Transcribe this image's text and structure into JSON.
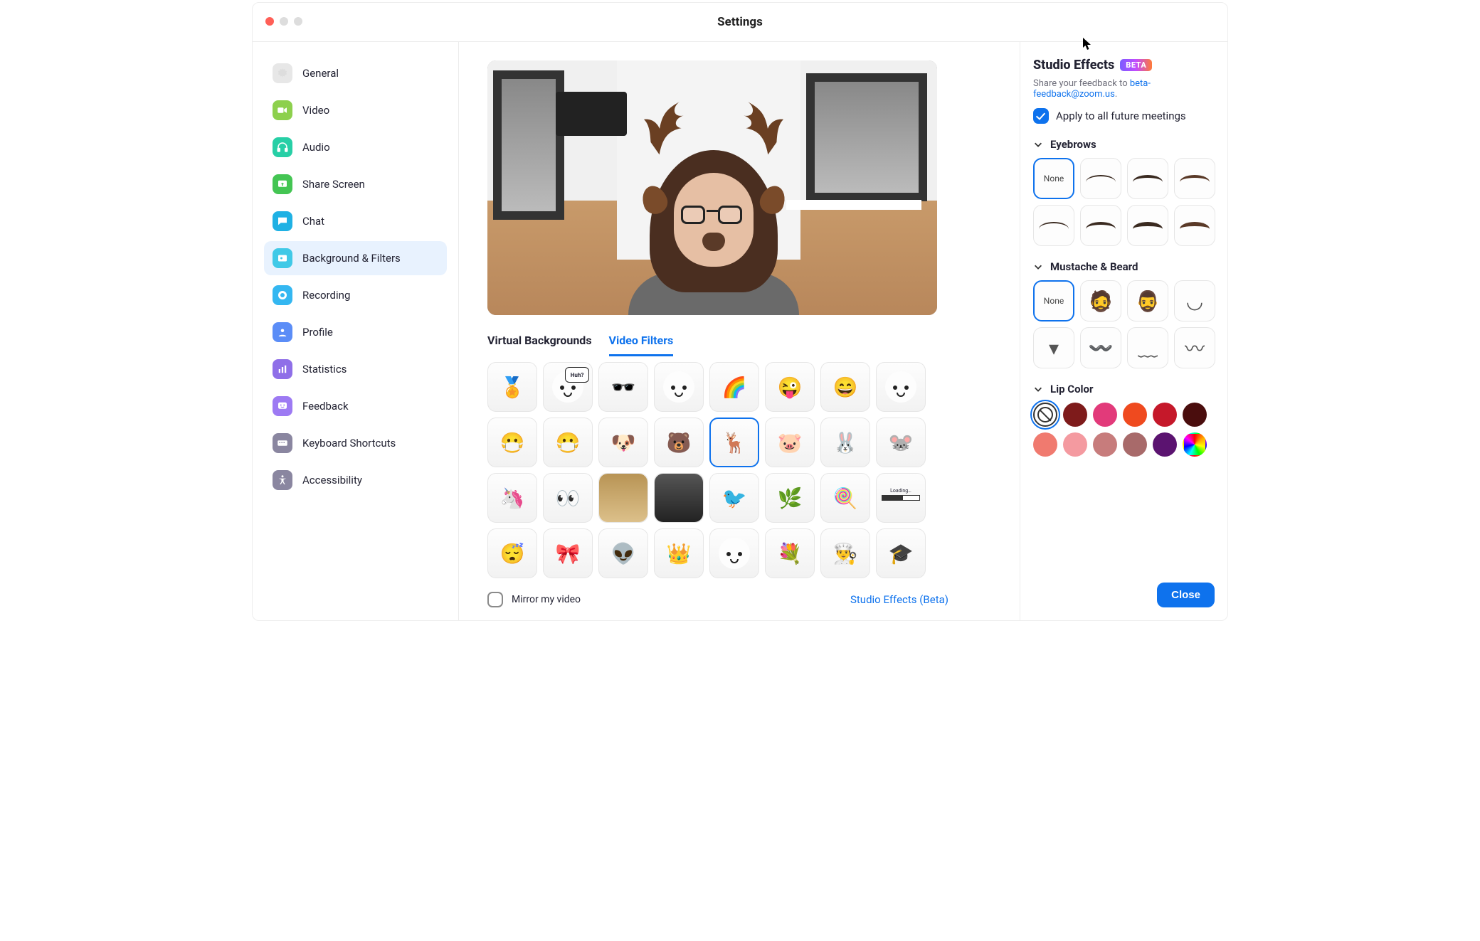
{
  "window": {
    "title": "Settings"
  },
  "sidebar": {
    "items": [
      {
        "label": "General",
        "icon": "gear-icon",
        "active": false
      },
      {
        "label": "Video",
        "icon": "video-icon",
        "active": false
      },
      {
        "label": "Audio",
        "icon": "headphones-icon",
        "active": false
      },
      {
        "label": "Share Screen",
        "icon": "share-icon",
        "active": false
      },
      {
        "label": "Chat",
        "icon": "chat-icon",
        "active": false
      },
      {
        "label": "Background & Filters",
        "icon": "bgfilters-icon",
        "active": true
      },
      {
        "label": "Recording",
        "icon": "record-icon",
        "active": false
      },
      {
        "label": "Profile",
        "icon": "profile-icon",
        "active": false
      },
      {
        "label": "Statistics",
        "icon": "stats-icon",
        "active": false
      },
      {
        "label": "Feedback",
        "icon": "feedback-icon",
        "active": false
      },
      {
        "label": "Keyboard Shortcuts",
        "icon": "keyboard-icon",
        "active": false
      },
      {
        "label": "Accessibility",
        "icon": "accessibility-icon",
        "active": false
      }
    ]
  },
  "main": {
    "tabs": [
      {
        "label": "Virtual Backgrounds",
        "active": false
      },
      {
        "label": "Video Filters",
        "active": true
      }
    ],
    "preview_filter_applied": "reindeer",
    "filters": [
      {
        "id": "award-ribbon"
      },
      {
        "id": "speech-huh",
        "label": "Huh?"
      },
      {
        "id": "pixel-sunglasses"
      },
      {
        "id": "cute-face"
      },
      {
        "id": "rainbow-headband"
      },
      {
        "id": "wink-tongue"
      },
      {
        "id": "big-smile"
      },
      {
        "id": "blank-face"
      },
      {
        "id": "face-mask-white"
      },
      {
        "id": "face-mask-teal"
      },
      {
        "id": "puppy-ears"
      },
      {
        "id": "bear-ears"
      },
      {
        "id": "reindeer",
        "selected": true
      },
      {
        "id": "pig-ears"
      },
      {
        "id": "bunny-ears"
      },
      {
        "id": "mouse-ears"
      },
      {
        "id": "unicorn-horn"
      },
      {
        "id": "cartoon-eyes"
      },
      {
        "id": "gold-photo-frame",
        "type": "image"
      },
      {
        "id": "dark-room-frame",
        "type": "image"
      },
      {
        "id": "cockatiel-bird"
      },
      {
        "id": "leafy-branch"
      },
      {
        "id": "lollipops-swirl"
      },
      {
        "id": "loading-bar",
        "label": "Loading…"
      },
      {
        "id": "sleeping-zzz"
      },
      {
        "id": "red-bow"
      },
      {
        "id": "green-antennae"
      },
      {
        "id": "gold-crown"
      },
      {
        "id": "mustache-face"
      },
      {
        "id": "hydrangea-flower"
      },
      {
        "id": "chef-hat"
      },
      {
        "id": "graduation-cap"
      }
    ],
    "mirror": {
      "label": "Mirror my video",
      "checked": false
    },
    "studio_link": "Studio Effects (Beta)"
  },
  "studio": {
    "title": "Studio Effects",
    "badge": "BETA",
    "feedback_prefix": "Share your feedback to ",
    "feedback_link": "beta-feedback@zoom.us",
    "feedback_suffix": ".",
    "apply_all": {
      "label": "Apply to all future meetings",
      "checked": true
    },
    "sections": {
      "eyebrows": {
        "title": "Eyebrows",
        "none_label": "None",
        "options": [
          "none",
          "brow-arched",
          "brow-flat",
          "brow-slim",
          "brow-angled",
          "brow-dark",
          "brow-thick",
          "brow-straight"
        ],
        "selected": "none"
      },
      "mustache": {
        "title": "Mustache & Beard",
        "none_label": "None",
        "options": [
          "none",
          "full-beard",
          "goatee",
          "chin-strap",
          "soul-patch",
          "mustache-thick",
          "mustache-thin",
          "handlebar"
        ],
        "selected": "none"
      },
      "lip_color": {
        "title": "Lip Color",
        "selected": "none",
        "swatches": [
          {
            "id": "none",
            "color": null
          },
          {
            "id": "wine",
            "color": "#7e1b1b"
          },
          {
            "id": "magenta",
            "color": "#e23a7a"
          },
          {
            "id": "orange",
            "color": "#ef4a1f"
          },
          {
            "id": "red",
            "color": "#c5182a"
          },
          {
            "id": "maroon",
            "color": "#4a0d0d"
          },
          {
            "id": "coral",
            "color": "#f07a6f"
          },
          {
            "id": "pink",
            "color": "#f49aa0"
          },
          {
            "id": "rose",
            "color": "#c77c7c"
          },
          {
            "id": "mauve",
            "color": "#a86a6a"
          },
          {
            "id": "purple",
            "color": "#5b1370"
          },
          {
            "id": "rainbow",
            "color": "rainbow"
          }
        ]
      }
    },
    "close_label": "Close"
  }
}
